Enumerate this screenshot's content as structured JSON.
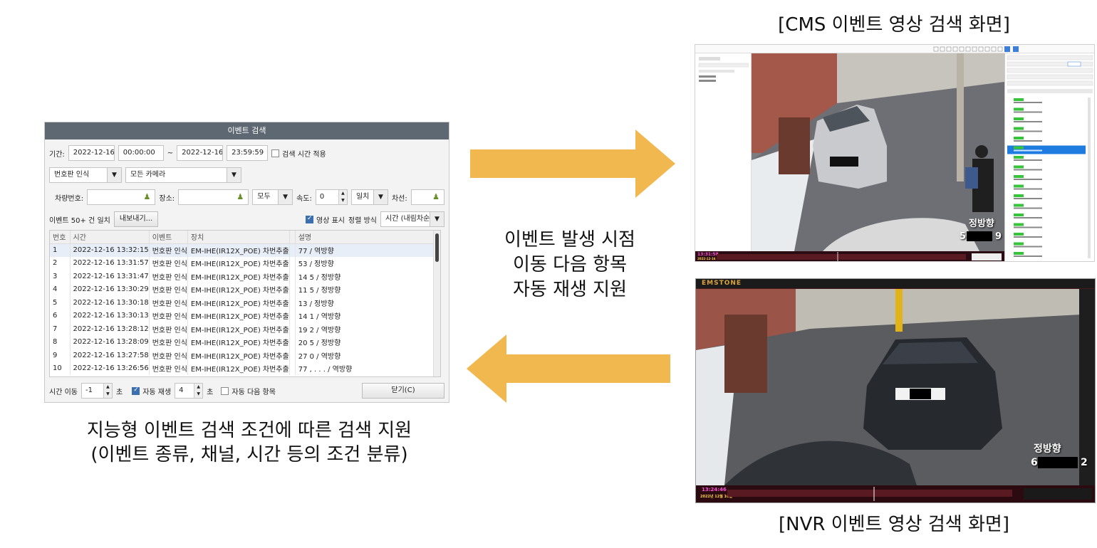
{
  "dialog": {
    "title": "이벤트 검색",
    "period_label": "기간:",
    "start_date": "2022-12-16",
    "start_time": "00:00:00",
    "tilde": "~",
    "end_date": "2022-12-16",
    "end_time": "23:59:59",
    "apply_search_time_label": "검색 시간 적용",
    "event_type": "번호판 인식",
    "camera": "모든 카메라",
    "plate_label": "차량번호:",
    "place_label": "장소:",
    "place_option": "모두",
    "speed_label": "속도:",
    "speed_value": "0",
    "speed_match": "일치",
    "lane_label": "차선:",
    "result_count": "이벤트 50+ 건 일치",
    "export_button": "내보내기...",
    "show_video_label": "영상 표시",
    "sort_label": "정렬 방식",
    "sort_value": "시간 (내림차순)",
    "columns": [
      "번호",
      "시간",
      "이벤트",
      "장치",
      "설명"
    ],
    "rows": [
      {
        "no": "1",
        "time": "2022-12-16 13:32:15",
        "event": "번호판 인식",
        "device": "EM-IHE(IR12X_POE) 차번추출",
        "desc": "77        / 역방향"
      },
      {
        "no": "2",
        "time": "2022-12-16 13:31:57",
        "event": "번호판 인식",
        "device": "EM-IHE(IR12X_POE) 차번추출",
        "desc": "53        / 정방향"
      },
      {
        "no": "3",
        "time": "2022-12-16 13:31:47",
        "event": "번호판 인식",
        "device": "EM-IHE(IR12X_POE) 차번추출",
        "desc": "14       5 / 정방향"
      },
      {
        "no": "4",
        "time": "2022-12-16 13:30:29",
        "event": "번호판 인식",
        "device": "EM-IHE(IR12X_POE) 차번추출",
        "desc": "11       5 / 정방향"
      },
      {
        "no": "5",
        "time": "2022-12-16 13:30:18",
        "event": "번호판 인식",
        "device": "EM-IHE(IR12X_POE) 차번추출",
        "desc": "13        / 정방향"
      },
      {
        "no": "6",
        "time": "2022-12-16 13:30:13",
        "event": "번호판 인식",
        "device": "EM-IHE(IR12X_POE) 차번추출",
        "desc": "14       1 / 역방향"
      },
      {
        "no": "7",
        "time": "2022-12-16 13:28:12",
        "event": "번호판 인식",
        "device": "EM-IHE(IR12X_POE) 차번추출",
        "desc": "19       2 / 역방향"
      },
      {
        "no": "8",
        "time": "2022-12-16 13:28:09",
        "event": "번호판 인식",
        "device": "EM-IHE(IR12X_POE) 차번추출",
        "desc": "20       5 / 정방향"
      },
      {
        "no": "9",
        "time": "2022-12-16 13:27:58",
        "event": "번호판 인식",
        "device": "EM-IHE(IR12X_POE) 차번추출",
        "desc": "27       0 / 역방향"
      },
      {
        "no": "10",
        "time": "2022-12-16 13:26:56",
        "event": "번호판 인식",
        "device": "EM-IHE(IR12X_POE) 차번추출",
        "desc": "77 , . . . / 역방향"
      }
    ],
    "time_move_label": "시간 이동",
    "time_move_value": "-1",
    "seconds_unit": "초",
    "auto_play_label": "자동 재생",
    "auto_play_value": "4",
    "auto_next_label": "자동 다음 항목",
    "close_button": "닫기(C)"
  },
  "captions": {
    "cms_title": "[CMS 이벤트 영상 검색 화면]",
    "nvr_title": "[NVR 이벤트 영상 검색 화면]",
    "center_line1": "이벤트 발생 시점",
    "center_line2": "이동 다음 항목",
    "center_line3": "자동 재생 지원",
    "left_line1": "지능형 이벤트 검색 조건에 따른 검색 지원",
    "left_line2": "(이벤트 종류, 채널, 시간 등의 조건 분류)"
  },
  "cms": {
    "direction_label": "정방향",
    "plate_left": "5",
    "plate_right": "9",
    "timestamp": "13:31:58",
    "date": "2022-12-16"
  },
  "nvr": {
    "logo": "EMSTONE",
    "direction_label": "정방향",
    "plate_left": "6",
    "plate_right": "2",
    "timestamp": "13:24:46",
    "date": "2022년 12월 16일"
  },
  "colors": {
    "arrow": "#f0b84f",
    "titlebar": "#5e6872"
  }
}
